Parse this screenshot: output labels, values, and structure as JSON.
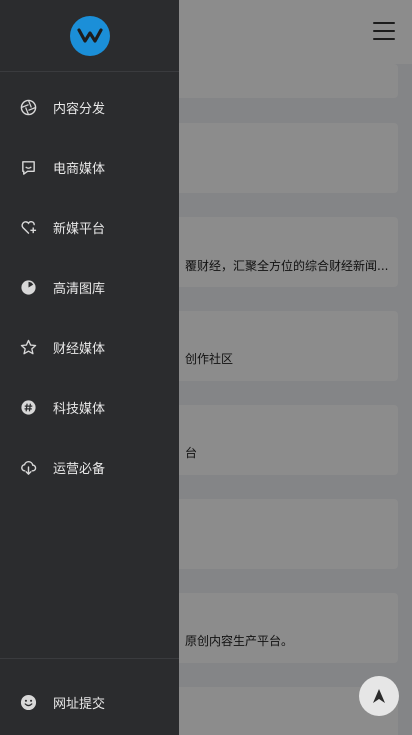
{
  "sidebar": {
    "logo_icon": "w-logo-icon",
    "items": [
      {
        "label": "内容分发",
        "icon": "aperture-icon"
      },
      {
        "label": "电商媒体",
        "icon": "chat-icon"
      },
      {
        "label": "新媒平台",
        "icon": "heart-plus-icon"
      },
      {
        "label": "高清图库",
        "icon": "pie-icon"
      },
      {
        "label": "财经媒体",
        "icon": "star-icon"
      },
      {
        "label": "科技媒体",
        "icon": "hash-icon"
      },
      {
        "label": "运营必备",
        "icon": "cloud-download-icon"
      }
    ],
    "footer": {
      "label": "网址提交",
      "icon": "smile-icon"
    }
  },
  "background": {
    "descriptions": [
      "覆财经，汇聚全方位的综合财经新闻...",
      "创作社区",
      "台",
      "原创内容生产平台。"
    ]
  },
  "colors": {
    "sidebar_bg": "#2b2c2e",
    "brand": "#1b8fd8"
  }
}
